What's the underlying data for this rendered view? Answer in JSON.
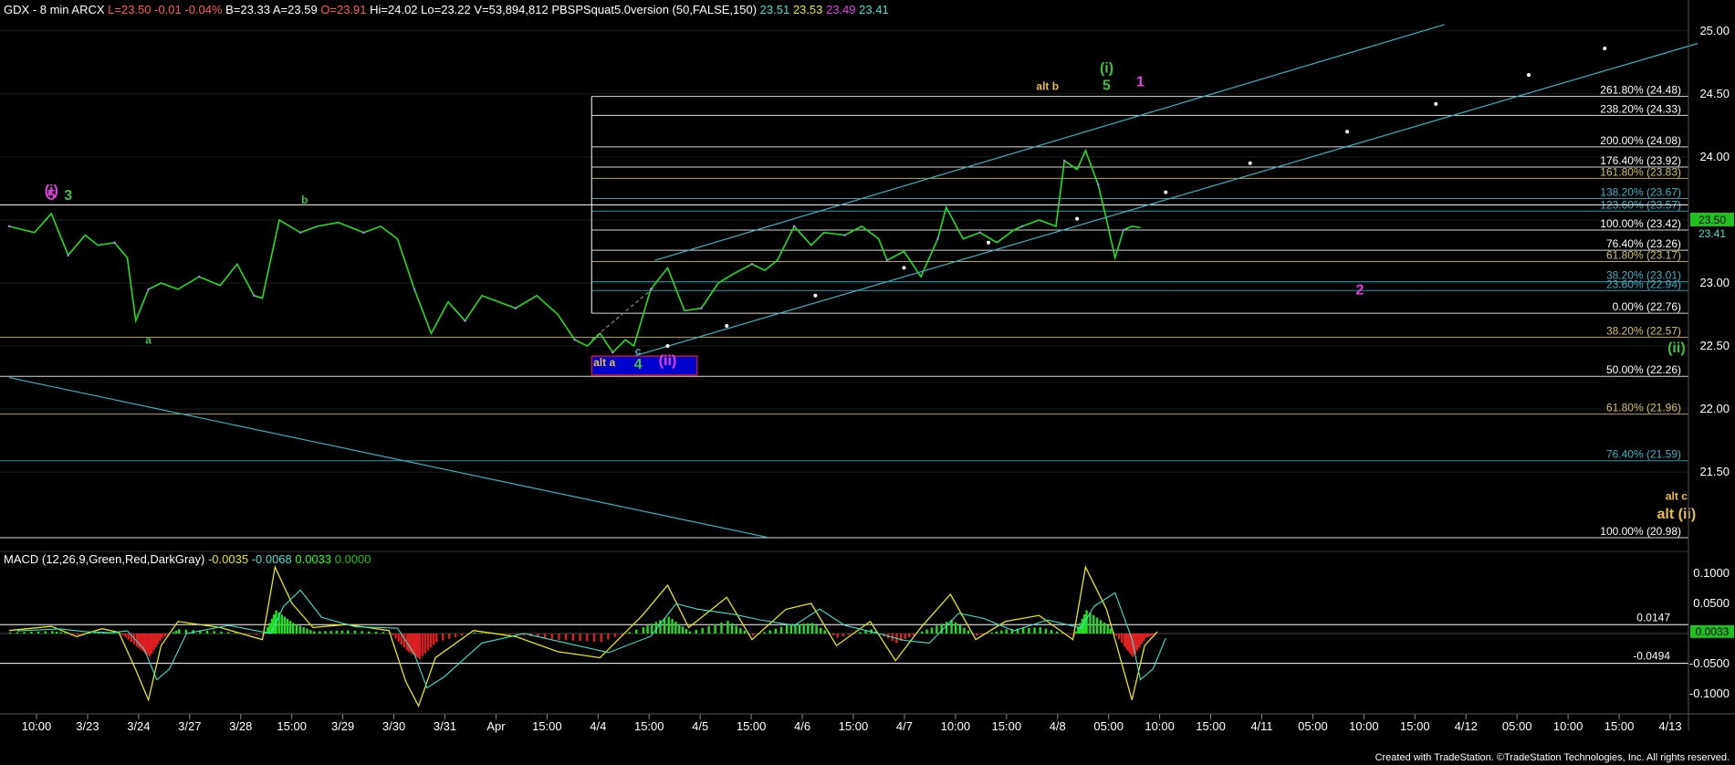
{
  "header": {
    "symbol_text": "GDX - 8 min  ARCX",
    "quote": [
      {
        "text": "L=23.50",
        "color": "#ff5a5a"
      },
      {
        "text": "-0.01",
        "color": "#ff5a5a"
      },
      {
        "text": "-0.04%",
        "color": "#ff5a5a"
      },
      {
        "text": "B=23.33",
        "color": "#ffffff"
      },
      {
        "text": "A=23.59",
        "color": "#ffffff"
      },
      {
        "text": "O=23.91",
        "color": "#ff5a5a"
      },
      {
        "text": "Hi=24.02",
        "color": "#ffffff"
      },
      {
        "text": "Lo=23.22",
        "color": "#ffffff"
      },
      {
        "text": "V=53,894,812",
        "color": "#ffffff"
      },
      {
        "text": "PBSPSquat5.0version (50,FALSE,150)",
        "color": "#ffffff"
      },
      {
        "text": "23.51",
        "color": "#40e0d0"
      },
      {
        "text": "23.53",
        "color": "#e8e800"
      },
      {
        "text": "23.49",
        "color": "#e040e0"
      },
      {
        "text": "23.41",
        "color": "#40e0d0"
      }
    ]
  },
  "macd_header": [
    {
      "text": "MACD (12,26,9,Green,Red,DarkGray)",
      "color": "#ffffff"
    },
    {
      "text": "-0.0035",
      "color": "#e8e800"
    },
    {
      "text": "-0.0068",
      "color": "#40e0d0"
    },
    {
      "text": "0.0033",
      "color": "#20ff20"
    },
    {
      "text": "0.0000",
      "color": "#20c020"
    }
  ],
  "chart_data": [
    {
      "type": "line",
      "name": "price",
      "ylim": [
        20.9,
        25.1
      ],
      "y_ticks": [
        "25.00",
        "24.50",
        "24.00",
        "23.50",
        "23.00",
        "22.50",
        "22.00",
        "21.50"
      ],
      "last_price": "23.50",
      "last_price2": "23.41",
      "fib_levels": [
        {
          "label": "261.80% (24.48)",
          "value": 24.48,
          "color": "#ffffff"
        },
        {
          "label": "238.20% (24.33)",
          "value": 24.33,
          "color": "#ffffff"
        },
        {
          "label": "200.00% (24.08)",
          "value": 24.08,
          "color": "#ffffff"
        },
        {
          "label": "176.40% (23.92)",
          "value": 23.92,
          "color": "#ffffff"
        },
        {
          "label": "161.80% (23.83)",
          "value": 23.83,
          "color": "#d4c060"
        },
        {
          "label": "138.20% (23.67)",
          "value": 23.67,
          "color": "#40b0c0"
        },
        {
          "label": "123.60% (23.57)",
          "value": 23.57,
          "color": "#40b0c0"
        },
        {
          "label": "100.00% (23.42)",
          "value": 23.42,
          "color": "#ffffff"
        },
        {
          "label": "76.40% (23.26)",
          "value": 23.26,
          "color": "#ffffff"
        },
        {
          "label": "61.80% (23.17)",
          "value": 23.17,
          "color": "#d4c060"
        },
        {
          "label": "38.20% (23.01)",
          "value": 23.01,
          "color": "#40b0c0"
        },
        {
          "label": "23.60% (22.94)",
          "value": 22.94,
          "color": "#40b0c0"
        },
        {
          "label": "0.00% (22.76)",
          "value": 22.76,
          "color": "#ffffff"
        },
        {
          "label": "38.20% (22.57)",
          "value": 22.57,
          "color": "#d4c060"
        },
        {
          "label": "50.00% (22.26)",
          "value": 22.26,
          "color": "#ffffff"
        },
        {
          "label": "61.80% (21.96)",
          "value": 21.96,
          "color": "#d4c060"
        },
        {
          "label": "76.40% (21.59)",
          "value": 21.59,
          "color": "#40b0c0"
        },
        {
          "label": "100.00% (20.98)",
          "value": 20.98,
          "color": "#ffffff"
        }
      ],
      "x_ticks": [
        "10:00",
        "3/23",
        "3/24",
        "3/27",
        "3/28",
        "15:00",
        "3/29",
        "3/30",
        "3/31",
        "Apr",
        "15:00",
        "4/4",
        "15:00",
        "4/5",
        "15:00",
        "4/6",
        "15:00",
        "4/7",
        "10:00",
        "15:00",
        "4/8",
        "05:00",
        "10:00",
        "15:00",
        "4/11",
        "05:00",
        "10:00",
        "15:00",
        "4/12",
        "05:00",
        "10:00",
        "15:00",
        "4/13"
      ],
      "price_path": [
        [
          0.0,
          23.45
        ],
        [
          0.6,
          23.4
        ],
        [
          1.0,
          23.55
        ],
        [
          1.4,
          23.22
        ],
        [
          1.8,
          23.38
        ],
        [
          2.1,
          23.3
        ],
        [
          2.5,
          23.32
        ],
        [
          2.8,
          23.2
        ],
        [
          3.0,
          22.7
        ],
        [
          3.3,
          22.95
        ],
        [
          3.6,
          23.0
        ],
        [
          4.0,
          22.95
        ],
        [
          4.5,
          23.05
        ],
        [
          5.0,
          22.98
        ],
        [
          5.4,
          23.15
        ],
        [
          5.8,
          22.9
        ],
        [
          6.0,
          22.88
        ],
        [
          6.4,
          23.5
        ],
        [
          6.9,
          23.4
        ],
        [
          7.3,
          23.45
        ],
        [
          7.8,
          23.48
        ],
        [
          8.4,
          23.4
        ],
        [
          8.8,
          23.45
        ],
        [
          9.2,
          23.35
        ],
        [
          9.6,
          22.95
        ],
        [
          10.0,
          22.6
        ],
        [
          10.4,
          22.85
        ],
        [
          10.8,
          22.7
        ],
        [
          11.2,
          22.9
        ],
        [
          11.6,
          22.85
        ],
        [
          12.0,
          22.8
        ],
        [
          12.5,
          22.9
        ],
        [
          13.0,
          22.75
        ],
        [
          13.4,
          22.55
        ],
        [
          13.7,
          22.5
        ],
        [
          14.0,
          22.6
        ],
        [
          14.3,
          22.45
        ],
        [
          14.6,
          22.55
        ],
        [
          14.8,
          22.5
        ],
        [
          15.2,
          22.95
        ],
        [
          15.6,
          23.12
        ],
        [
          16.0,
          22.78
        ],
        [
          16.4,
          22.8
        ],
        [
          16.8,
          23.0
        ],
        [
          17.2,
          23.08
        ],
        [
          17.6,
          23.15
        ],
        [
          17.9,
          23.1
        ],
        [
          18.2,
          23.18
        ],
        [
          18.6,
          23.45
        ],
        [
          19.0,
          23.3
        ],
        [
          19.3,
          23.4
        ],
        [
          19.8,
          23.38
        ],
        [
          20.2,
          23.45
        ],
        [
          20.6,
          23.35
        ],
        [
          20.8,
          23.18
        ],
        [
          21.2,
          23.25
        ],
        [
          21.6,
          23.05
        ],
        [
          22.0,
          23.35
        ],
        [
          22.2,
          23.6
        ],
        [
          22.6,
          23.35
        ],
        [
          23.0,
          23.4
        ],
        [
          23.4,
          23.32
        ],
        [
          23.8,
          23.42
        ],
        [
          24.0,
          23.45
        ],
        [
          24.4,
          23.5
        ],
        [
          24.8,
          23.45
        ],
        [
          25.0,
          23.97
        ],
        [
          25.3,
          23.9
        ],
        [
          25.5,
          24.05
        ],
        [
          25.8,
          23.78
        ],
        [
          26.0,
          23.5
        ],
        [
          26.2,
          23.2
        ],
        [
          26.4,
          23.42
        ],
        [
          26.6,
          23.45
        ],
        [
          26.8,
          23.44
        ]
      ],
      "channel_upper": [
        [
          15.3,
          23.18
        ],
        [
          34.0,
          25.05
        ]
      ],
      "channel_lower": [
        [
          14.6,
          22.4
        ],
        [
          40.0,
          24.9
        ]
      ],
      "channel_lower_dots": [
        [
          15.6,
          22.5
        ],
        [
          17.0,
          22.66
        ],
        [
          19.1,
          22.9
        ],
        [
          21.2,
          23.12
        ],
        [
          23.2,
          23.32
        ],
        [
          25.3,
          23.51
        ],
        [
          27.4,
          23.72
        ],
        [
          29.4,
          23.95
        ],
        [
          31.7,
          24.2
        ],
        [
          33.8,
          24.42
        ],
        [
          36.0,
          24.65
        ],
        [
          37.8,
          24.86
        ]
      ],
      "downtrend": [
        [
          0.0,
          22.25
        ],
        [
          18.0,
          20.98
        ]
      ],
      "dashed_line": [
        [
          13.8,
          22.55
        ],
        [
          15.3,
          22.97
        ]
      ],
      "resistance_y": 23.62,
      "box_alt_a": {
        "x1": 13.8,
        "x2": 16.3,
        "y1": 22.42,
        "y2": 22.27
      },
      "annotations": [
        {
          "text": "(i)",
          "x": 1.0,
          "y": 23.7,
          "color": "#e040e0"
        },
        {
          "text": "5",
          "x": 1.0,
          "y": 23.66,
          "color": "#e040e0"
        },
        {
          "text": "3",
          "x": 1.4,
          "y": 23.66,
          "color": "#40c040"
        },
        {
          "text": "b",
          "x": 7.0,
          "y": 23.63,
          "color": "#40c040"
        },
        {
          "text": "a",
          "x": 3.3,
          "y": 22.52,
          "color": "#40c040"
        },
        {
          "text": "alt a",
          "x": 14.1,
          "y": 22.34,
          "color": "#e8c040"
        },
        {
          "text": "c",
          "x": 14.9,
          "y": 22.43,
          "color": "#40b0c0"
        },
        {
          "text": "4",
          "x": 14.9,
          "y": 22.32,
          "color": "#40c040"
        },
        {
          "text": "(ii)",
          "x": 15.6,
          "y": 22.35,
          "color": "#e040e0"
        },
        {
          "text": "alt b",
          "x": 24.6,
          "y": 24.53,
          "color": "#e8c040"
        },
        {
          "text": "(i)",
          "x": 26.0,
          "y": 24.67,
          "color": "#40c040"
        },
        {
          "text": "5",
          "x": 26.0,
          "y": 24.53,
          "color": "#40c040"
        },
        {
          "text": "1",
          "x": 26.8,
          "y": 24.56,
          "color": "#e040e0"
        },
        {
          "text": "2",
          "x": 32.0,
          "y": 22.91,
          "color": "#e040e0"
        },
        {
          "text": "(ii)",
          "x": 39.5,
          "y": 22.45,
          "color": "#40c040"
        },
        {
          "text": "alt c",
          "x": 39.5,
          "y": 21.28,
          "color": "#e8c040"
        },
        {
          "text": "alt (ii)",
          "x": 39.5,
          "y": 21.13,
          "color": "#e8c040"
        }
      ]
    },
    {
      "type": "line",
      "name": "MACD",
      "ylim": [
        -0.13,
        0.13
      ],
      "y_ticks": [
        "0.1000",
        "0.0500",
        "0.0000",
        "-0.0500",
        "-0.1000"
      ],
      "reference_lines": [
        {
          "label": "0.0147",
          "value": 0.0147
        },
        {
          "label": "-0.0494",
          "value": -0.0494
        }
      ],
      "last_value": "0.0033",
      "macd_path": [
        [
          0.0,
          0.005
        ],
        [
          1.0,
          0.012
        ],
        [
          1.6,
          -0.005
        ],
        [
          2.2,
          0.008
        ],
        [
          2.6,
          0.002
        ],
        [
          3.0,
          -0.06
        ],
        [
          3.3,
          -0.11
        ],
        [
          3.6,
          -0.02
        ],
        [
          4.0,
          0.02
        ],
        [
          5.0,
          0.01
        ],
        [
          6.0,
          -0.01
        ],
        [
          6.3,
          0.11
        ],
        [
          6.7,
          0.05
        ],
        [
          7.2,
          0.01
        ],
        [
          8.0,
          0.015
        ],
        [
          9.0,
          0.005
        ],
        [
          9.4,
          -0.08
        ],
        [
          9.7,
          -0.12
        ],
        [
          10.1,
          -0.04
        ],
        [
          11.0,
          0.005
        ],
        [
          12.0,
          -0.005
        ],
        [
          13.0,
          -0.03
        ],
        [
          14.0,
          -0.04
        ],
        [
          15.0,
          0.03
        ],
        [
          15.6,
          0.08
        ],
        [
          16.1,
          0.01
        ],
        [
          17.0,
          0.06
        ],
        [
          17.6,
          -0.01
        ],
        [
          18.4,
          0.04
        ],
        [
          19.0,
          0.05
        ],
        [
          19.6,
          -0.02
        ],
        [
          20.4,
          0.02
        ],
        [
          21.0,
          -0.045
        ],
        [
          21.6,
          0.01
        ],
        [
          22.3,
          0.065
        ],
        [
          22.9,
          -0.01
        ],
        [
          23.6,
          0.02
        ],
        [
          24.4,
          0.03
        ],
        [
          25.2,
          -0.01
        ],
        [
          25.5,
          0.11
        ],
        [
          26.0,
          0.04
        ],
        [
          26.4,
          -0.06
        ],
        [
          26.6,
          -0.11
        ],
        [
          26.9,
          -0.02
        ],
        [
          27.2,
          0.003
        ]
      ]
    }
  ],
  "footer": "Created with TradeStation. ©TradeStation Technologies, Inc. All rights reserved."
}
